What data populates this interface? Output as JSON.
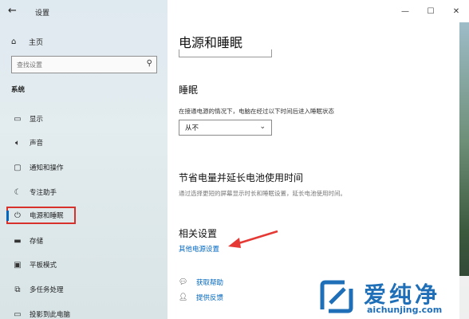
{
  "window": {
    "title": "设置",
    "controls": [
      "—",
      "☐",
      "✕"
    ]
  },
  "sidebar": {
    "home_label": "主页",
    "search_placeholder": "查找设置",
    "section_label": "系统",
    "items": [
      {
        "label": "显示",
        "icon": "display-icon"
      },
      {
        "label": "声音",
        "icon": "sound-icon"
      },
      {
        "label": "通知和操作",
        "icon": "notification-icon"
      },
      {
        "label": "专注助手",
        "icon": "moon-icon"
      },
      {
        "label": "电源和睡眠",
        "icon": "power-icon",
        "selected": true
      },
      {
        "label": "存储",
        "icon": "storage-icon"
      },
      {
        "label": "平板模式",
        "icon": "tablet-icon"
      },
      {
        "label": "多任务处理",
        "icon": "multitask-icon"
      },
      {
        "label": "投影到此电脑",
        "icon": "project-icon"
      }
    ]
  },
  "main": {
    "title": "电源和睡眠",
    "sleep": {
      "heading": "睡眠",
      "description": "在接通电源的情况下，电脑在经过以下时间后进入睡眠状态",
      "selected_value": "从不"
    },
    "battery": {
      "heading": "节省电量并延长电池使用时间",
      "description": "通过选择更短的屏幕显示时长和睡眠设置，延长电池使用时间。"
    },
    "related": {
      "heading": "相关设置",
      "link": "其他电源设置"
    },
    "help": {
      "get_help": "获取帮助",
      "feedback": "提供反馈"
    }
  },
  "watermark": {
    "cn": "爱纯净",
    "en": "aichunjing.com"
  },
  "colors": {
    "accent": "#0067c0",
    "highlight_box": "#d8302b",
    "annotation_arrow": "#e53935"
  }
}
